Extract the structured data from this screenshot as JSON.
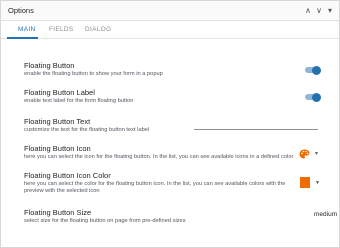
{
  "panel": {
    "title": "Options",
    "controls": {
      "move_up": "∧",
      "move_down": "∨",
      "toggle": "▾"
    }
  },
  "tabs": [
    {
      "label": "MAIN",
      "active": true
    },
    {
      "label": "FIELDS",
      "active": false
    },
    {
      "label": "DIALOG",
      "active": false
    }
  ],
  "settings": {
    "floating_button": {
      "title": "Floating Button",
      "description": "enable the floating button to show your form in a popup",
      "enabled": true
    },
    "floating_button_label": {
      "title": "Floating Button Label",
      "description": "enable text label for the form floating button",
      "enabled": true
    },
    "floating_button_text": {
      "title": "Floating Button Text",
      "description": "customize the text for the floating button text label",
      "value": ""
    },
    "floating_button_icon": {
      "title": "Floating Button Icon",
      "description": "here you can select the icon for the floating button. In the list, you can see available icons in a defined color",
      "icon": "palette-icon",
      "caret": "▼"
    },
    "floating_button_icon_color": {
      "title": "Floating Button Icon Color",
      "description": "here you can select the color for the floating button icon. In the list, you can see available colors with the preview with the selected icon",
      "color": "#ef6c00",
      "caret": "▼"
    },
    "floating_button_size": {
      "title": "Floating Button Size",
      "description": "select size for the floating button on page from pre-defined sizes",
      "value": "medium",
      "caret": "▼"
    }
  },
  "colors": {
    "accent": "#2271b1",
    "icon_orange": "#ef6c00"
  }
}
